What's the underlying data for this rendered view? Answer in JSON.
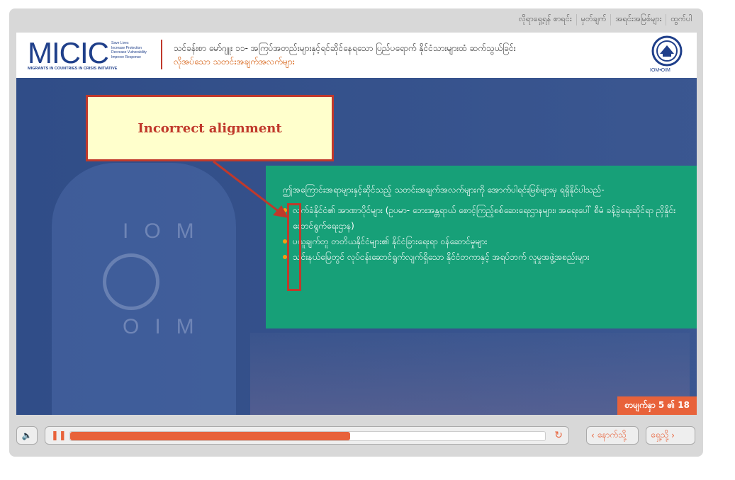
{
  "topnav": [
    "လိုရာရှေ့ရန် စာရင်း",
    "မှတ်ချက်",
    "အရင်းအမြစ်များ",
    "ထွက်ပါ"
  ],
  "header": {
    "logo_main": "MICIC",
    "logo_tagline": [
      "Save Lives",
      "Increase Protection",
      "Decrease Vulnerability",
      "Improve Response"
    ],
    "logo_sub": "MIGRANTS IN COUNTRIES IN CRISIS INITIATIVE",
    "course_title": "သင်ခန်းစာ မော်ဂျူး ၁၁- အကြပ်အတည်းများနှင့်ရင်ဆိုင်နေရသော ပြည်ပရောက် နိုင်ငံသားများထံ ဆက်သွယ်ခြင်း",
    "course_sub": "လိုအပ်သော သတင်းအချက်အလက်များ",
    "iom_label": "IOM•OIM"
  },
  "stage": {
    "bg_iom": "IOM",
    "bg_oim": "OIM",
    "callout": "Incorrect alignment",
    "panel_intro": "ဤအကြောင်းအရာများနှင့်ဆိုင်သည့် သတင်းအချက်အလက်များကို အောက်ပါရင်းမြစ်များမှ ရရှိနိုင်ပါသည်-",
    "panel_items": [
      "လက်ခံနိုင်ငံ၏ အာဏာပိုင်များ (ဥပမာ- ဘေးအန္တရာယ် စောင့်ကြည့်စစ်ဆေးရေးဌာနများ၊ အရေးပေါ် စီမံ ခန့်ခွဲရေးဆိုင်ရာ ညှိနှိုင်းဆောင်ရွက်ရေးဌာန)",
      "ပယူချက်တူ တတိယနိုင်ငံများ၏ နိုင်ငံခြားရေးရာ ဝန်ဆောင်မှုများ",
      "သင်းနယ်မြေတွင် လုပ်ငန်းဆောင်ရွက်လျက်ရှိသော နိုင်ငံတကာနှင့် အရပ်ဘက် လူမှုအဖွဲ့အစည်းများ"
    ],
    "slide_counter": "စာမျက်နှာ 5 ၏ 18"
  },
  "controls": {
    "volume_icon": "speaker-icon",
    "pause_icon": "pause-icon",
    "progress": 0.59,
    "replay_icon": "replay-icon",
    "prev_label": "နောက်သို့",
    "next_label": "ရှေ့သို့",
    "accent": "#e8623a"
  }
}
